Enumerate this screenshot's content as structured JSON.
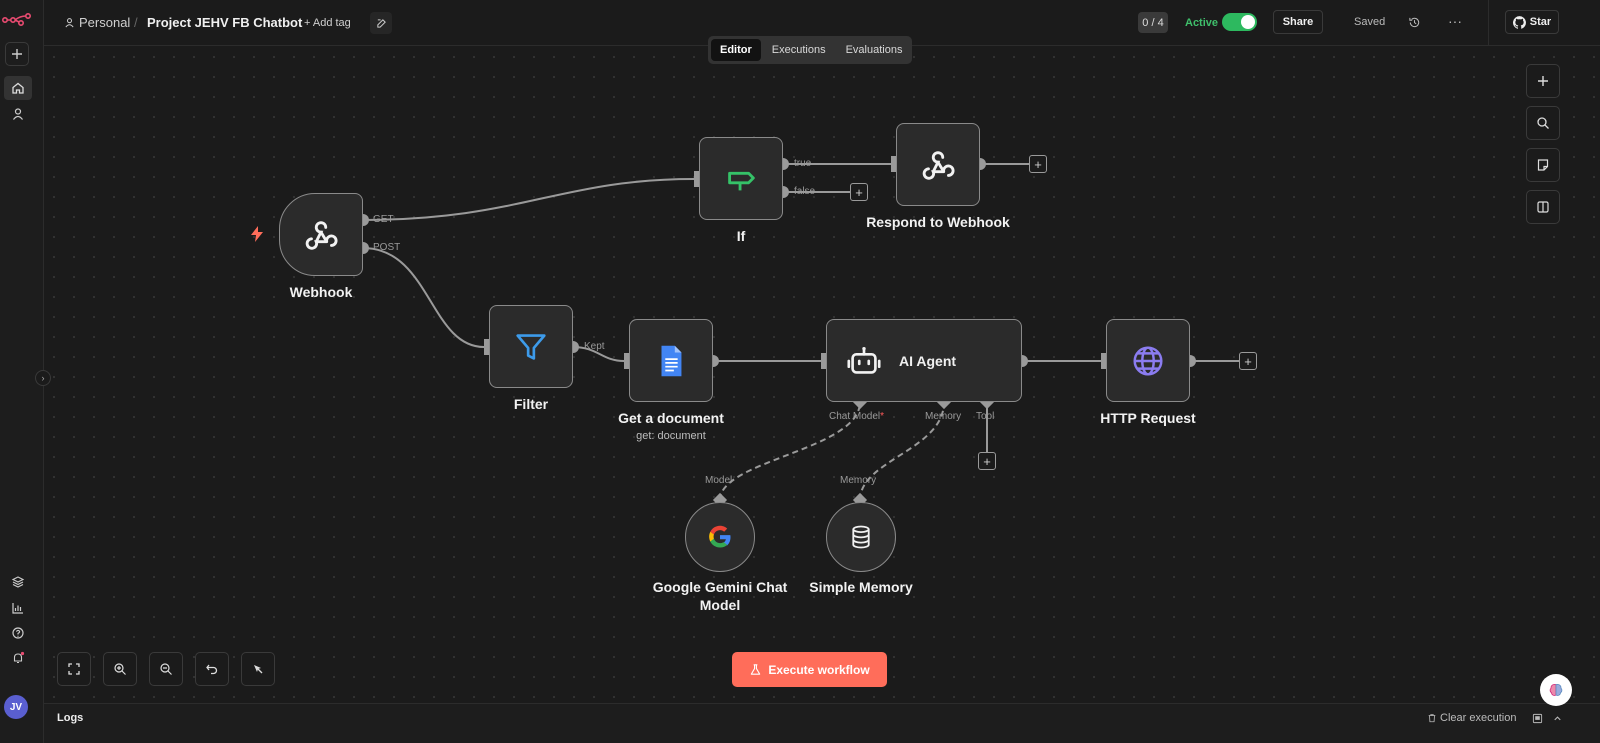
{
  "header": {
    "workspace": "Personal",
    "separator": "/",
    "project_name": "Project JEHV FB Chatbot",
    "add_tag": "+ Add tag",
    "counter": "0 / 4",
    "active_label": "Active",
    "active": true,
    "share": "Share",
    "saved": "Saved",
    "more": "···",
    "star": "Star"
  },
  "tabs": [
    {
      "label": "Editor",
      "active": true
    },
    {
      "label": "Executions",
      "active": false
    },
    {
      "label": "Evaluations",
      "active": false
    }
  ],
  "nodes": {
    "webhook": {
      "label": "Webhook",
      "outputs": [
        "GET",
        "POST"
      ],
      "icon": "webhook-icon"
    },
    "if": {
      "label": "If",
      "outputs": [
        "true",
        "false"
      ],
      "icon": "signpost-icon"
    },
    "respond": {
      "label": "Respond to Webhook",
      "icon": "webhook-icon"
    },
    "filter": {
      "label": "Filter",
      "outputs": [
        "Kept"
      ],
      "icon": "funnel-icon"
    },
    "gdoc": {
      "label": "Get a document",
      "subtitle": "get: document",
      "icon": "google-docs-icon"
    },
    "agent": {
      "label": "AI Agent",
      "inputs": [
        "Chat Model",
        "Memory",
        "Tool"
      ],
      "required_mark": "*",
      "icon": "robot-icon"
    },
    "http": {
      "label": "HTTP Request",
      "icon": "globe-icon"
    },
    "gemini": {
      "label": "Google Gemini Chat Model",
      "port_label": "Model",
      "icon": "google-g-icon"
    },
    "memory": {
      "label": "Simple Memory",
      "port_label": "Memory",
      "icon": "database-icon"
    }
  },
  "execute_button": "Execute workflow",
  "logs": {
    "title": "Logs",
    "clear": "Clear execution"
  },
  "user": {
    "initials": "JV"
  },
  "colors": {
    "accent": "#ff6d5a",
    "active_green": "#2db95f",
    "node_border": "#8a8a8a",
    "canvas_bg": "#1b1b1b"
  }
}
